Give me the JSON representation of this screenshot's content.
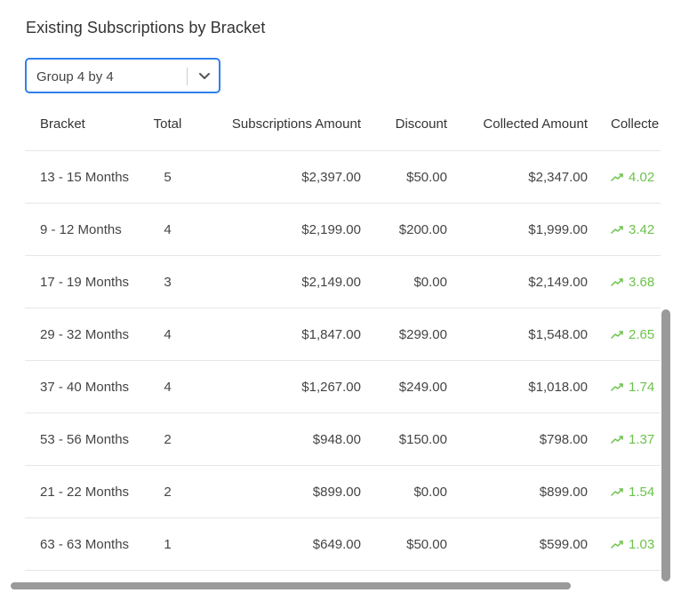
{
  "header": {
    "title": "Existing Subscriptions by Bracket"
  },
  "group_select": {
    "value": "Group 4 by 4",
    "icon": "chevron-down-icon"
  },
  "table": {
    "columns": [
      "Bracket",
      "Total",
      "Subscriptions Amount",
      "Discount",
      "Collected Amount",
      "Collecte"
    ],
    "rows": [
      {
        "bracket": "13 - 15 Months",
        "total": "5",
        "subscriptions_amount": "$2,397.00",
        "discount": "$50.00",
        "collected_amount": "$2,347.00",
        "collected_rate": "4.02"
      },
      {
        "bracket": "9 - 12 Months",
        "total": "4",
        "subscriptions_amount": "$2,199.00",
        "discount": "$200.00",
        "collected_amount": "$1,999.00",
        "collected_rate": "3.42"
      },
      {
        "bracket": "17 - 19 Months",
        "total": "3",
        "subscriptions_amount": "$2,149.00",
        "discount": "$0.00",
        "collected_amount": "$2,149.00",
        "collected_rate": "3.68"
      },
      {
        "bracket": "29 - 32 Months",
        "total": "4",
        "subscriptions_amount": "$1,847.00",
        "discount": "$299.00",
        "collected_amount": "$1,548.00",
        "collected_rate": "2.65"
      },
      {
        "bracket": "37 - 40 Months",
        "total": "4",
        "subscriptions_amount": "$1,267.00",
        "discount": "$249.00",
        "collected_amount": "$1,018.00",
        "collected_rate": "1.74"
      },
      {
        "bracket": "53 - 56 Months",
        "total": "2",
        "subscriptions_amount": "$948.00",
        "discount": "$150.00",
        "collected_amount": "$798.00",
        "collected_rate": "1.37"
      },
      {
        "bracket": "21 - 22 Months",
        "total": "2",
        "subscriptions_amount": "$899.00",
        "discount": "$0.00",
        "collected_amount": "$899.00",
        "collected_rate": "1.54"
      },
      {
        "bracket": "63 - 63 Months",
        "total": "1",
        "subscriptions_amount": "$649.00",
        "discount": "$50.00",
        "collected_amount": "$599.00",
        "collected_rate": "1.03"
      }
    ]
  },
  "colors": {
    "accent": "#2f80ed",
    "trend_up": "#6cc24a",
    "scrollbar": "#9a9a9a"
  }
}
